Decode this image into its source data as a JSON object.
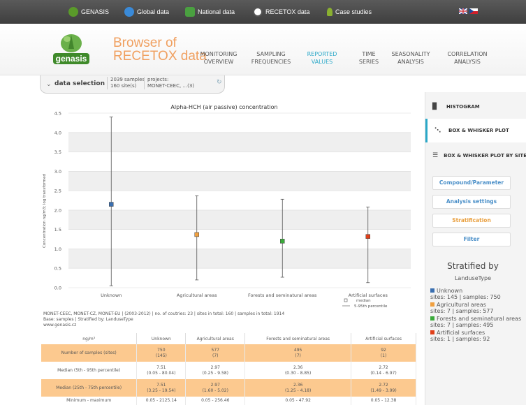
{
  "topbar": {
    "items": [
      {
        "label": "GENASIS",
        "icon": "genasis-icon",
        "color": "#5a9a2a"
      },
      {
        "label": "Global data",
        "icon": "globe-icon",
        "color": "#3a8ad8"
      },
      {
        "label": "National data",
        "icon": "map-icon",
        "color": "#4aa040"
      },
      {
        "label": "RECETOX data",
        "icon": "recetox-icon",
        "color": "#cccccc"
      },
      {
        "label": "Case studies",
        "icon": "pin-icon",
        "color": "#8ab030"
      }
    ],
    "languages": [
      "uk-flag-icon",
      "cz-flag-icon"
    ]
  },
  "header": {
    "title_line1": "Browser of",
    "title_line2": "RECETOX data",
    "logo_text": "genasis",
    "nav": [
      {
        "l1": "MONITORING",
        "l2": "OVERVIEW"
      },
      {
        "l1": "SAMPLING",
        "l2": "FREQUENCIES"
      },
      {
        "l1": "REPORTED",
        "l2": "VALUES"
      },
      {
        "l1": "TIME",
        "l2": "SERIES"
      },
      {
        "l1": "SEASONALITY",
        "l2": "ANALYSIS"
      },
      {
        "l1": "CORRELATION",
        "l2": "ANALYSIS"
      }
    ],
    "active_nav": 2
  },
  "data_selection": {
    "label": "data selection",
    "samples": "2039 samples",
    "sites": "160 site(s)",
    "projects_label": "projects:",
    "projects_value": "MONET-CEEC, ...(3)"
  },
  "chart_data": {
    "type": "box",
    "title": "Alpha-HCH (air passive) concentration",
    "ylabel": "Concentration ng/m3; log transformed",
    "ylim": [
      0,
      4.5
    ],
    "yticks": [
      "0.0",
      "0.5",
      "1.0",
      "1.5",
      "2.0",
      "2.5",
      "3.0",
      "3.5",
      "4.0",
      "4.5"
    ],
    "categories": [
      "Unknown",
      "Agricultural areas",
      "Forests and seminatural areas",
      "Artificial surfaces"
    ],
    "series": [
      {
        "median": 2.15,
        "low": 0.05,
        "high": 4.4,
        "color": "#3a6fb0"
      },
      {
        "median": 1.37,
        "low": 0.2,
        "high": 2.37,
        "color": "#f0a040"
      },
      {
        "median": 1.2,
        "low": 0.27,
        "high": 2.28,
        "color": "#3aaa3a"
      },
      {
        "median": 1.32,
        "low": 0.13,
        "high": 2.08,
        "color": "#e0401a"
      }
    ],
    "legend": {
      "median": "median",
      "range": "5-95th percentile"
    }
  },
  "footnote": {
    "line1": "MONET-CEEC, MONET-CZ, MONET-EU | (2003-2012) | no. of coutries: 23 | sites in total: 160 | samples in total: 1914",
    "line2": "Base: samples | Stratified by: LanduseType",
    "line3": "www.genasis.cz"
  },
  "table": {
    "header": [
      "ng/m³",
      "Unknown",
      "Agricultural areas",
      "Forests and seminatural areas",
      "Artificial surfaces"
    ],
    "rows": [
      {
        "label": "Number of samples (sites)",
        "cells": [
          [
            "750",
            "(145)"
          ],
          [
            "577",
            "(7)"
          ],
          [
            "495",
            "(7)"
          ],
          [
            "92",
            "(1)"
          ]
        ]
      },
      {
        "label": "Median (5th - 95th percentile)",
        "cells": [
          [
            "7.51",
            "(0.05 - 80.04)"
          ],
          [
            "2.97",
            "(0.25 - 9.58)"
          ],
          [
            "2.36",
            "(0.30 - 8.85)"
          ],
          [
            "2.72",
            "(0.14 - 6.97)"
          ]
        ]
      },
      {
        "label": "Median (25th - 75th percentile)",
        "cells": [
          [
            "7.51",
            "(3.25 - 19.54)"
          ],
          [
            "2.97",
            "(1.60 - 5.02)"
          ],
          [
            "2.36",
            "(1.25 - 4.18)"
          ],
          [
            "2.72",
            "(1.49 - 3.99)"
          ]
        ]
      },
      {
        "label": "Minimum - maximum",
        "cells": [
          [
            "0.05 - 2125.14"
          ],
          [
            "0.05 - 256.46"
          ],
          [
            "0.05 - 47.92"
          ],
          [
            "0.05 - 12.38"
          ]
        ]
      }
    ]
  },
  "sidebar": {
    "items": [
      {
        "label": "HISTOGRAM",
        "icon": "bar-chart-icon"
      },
      {
        "label": "BOX & WHISKER PLOT",
        "icon": "box-plot-icon"
      },
      {
        "label": "BOX & WHISKER PLOT BY SITE",
        "icon": "box-plot-list-icon"
      }
    ],
    "active_item": 1,
    "buttons": [
      "Compound/Parameter",
      "Analysis settings",
      "Stratification",
      "Filter"
    ],
    "strat_title": "Stratified by",
    "strat_sub": "LanduseType",
    "legend": [
      {
        "name": "Unknown",
        "stats": "sites: 145 | samples: 750",
        "color": "#3a6fb0"
      },
      {
        "name": "Agricultural areas",
        "stats": "sites: 7 | samples: 577",
        "color": "#f0a040"
      },
      {
        "name": "Forests and seminatural areas",
        "stats": "sites: 7 | samples: 495",
        "color": "#3aaa3a"
      },
      {
        "name": "Artificial surfaces",
        "stats": "sites: 1 | samples: 92",
        "color": "#e0401a"
      }
    ]
  }
}
